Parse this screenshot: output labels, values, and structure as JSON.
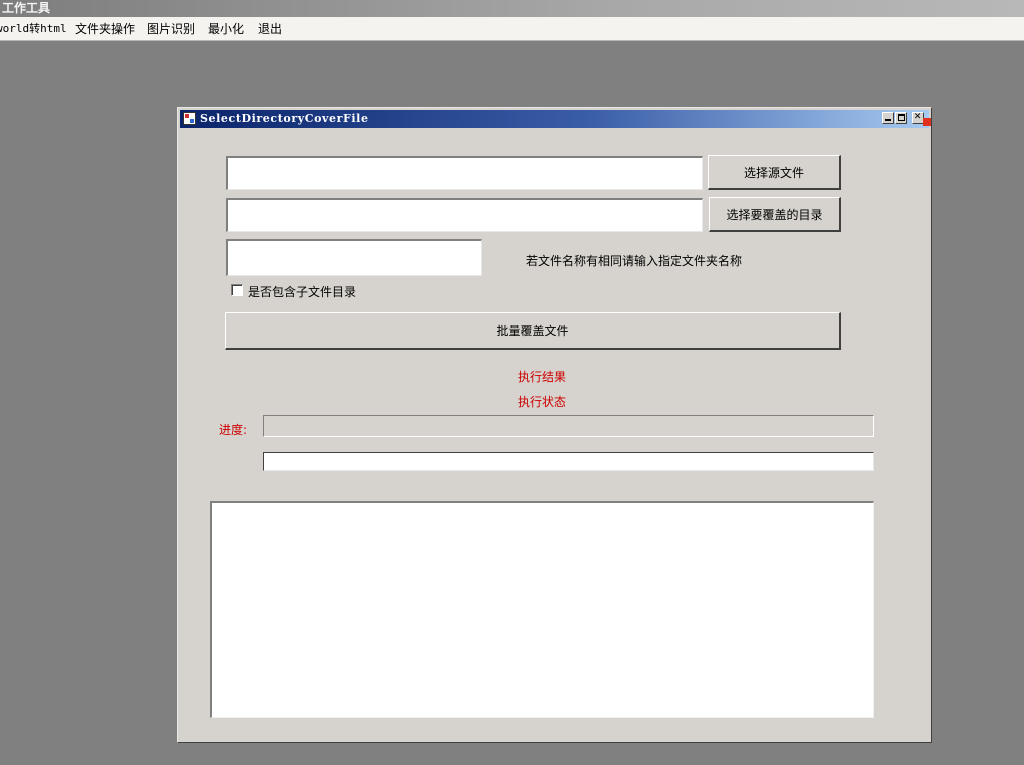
{
  "app": {
    "title": "工作工具",
    "menu": [
      {
        "label": "world转html"
      },
      {
        "label": "文件夹操作"
      },
      {
        "label": "图片识别"
      },
      {
        "label": "最小化"
      },
      {
        "label": "退出"
      }
    ]
  },
  "window": {
    "title": "SelectDirectoryCoverFile",
    "source_file_value": "",
    "target_dir_value": "",
    "folder_name_value": "",
    "select_source_label": "选择源文件",
    "select_target_label": "选择要覆盖的目录",
    "folder_name_hint": "若文件名称有相同请输入指定文件夹名称",
    "include_subdirs_label": "是否包含子文件目录",
    "include_subdirs_checked": false,
    "batch_cover_label": "批量覆盖文件",
    "result_label": "执行结果",
    "status_label": "执行状态",
    "progress_label": "进度:",
    "progress_value": 0,
    "current_file_value": "",
    "log_text": ""
  },
  "colors": {
    "desktop": "#808080",
    "window_bg": "#d6d3ce",
    "titlebar_start": "#0a246a",
    "titlebar_end": "#a6caf0",
    "accent_red": "#cc0000"
  }
}
